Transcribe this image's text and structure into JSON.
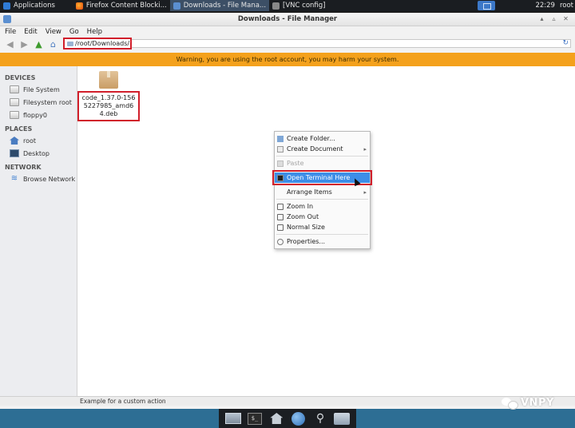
{
  "top_panel": {
    "apps_label": "Applications",
    "tasks": [
      {
        "label": "Firefox Content Blocki..."
      },
      {
        "label": "Downloads - File Mana..."
      },
      {
        "label": "[VNC config]"
      }
    ],
    "clock": "22:29",
    "user": "root"
  },
  "window": {
    "title": "Downloads - File Manager"
  },
  "menubar": {
    "items": [
      "File",
      "Edit",
      "View",
      "Go",
      "Help"
    ]
  },
  "address": {
    "path": "/root/Downloads/"
  },
  "warning": "Warning, you are using the root account, you may harm your system.",
  "sidebar": {
    "devices_header": "DEVICES",
    "devices": [
      "File System",
      "Filesystem root",
      "floppy0"
    ],
    "places_header": "PLACES",
    "places": [
      "root",
      "Desktop"
    ],
    "network_header": "NETWORK",
    "network": [
      "Browse Network"
    ]
  },
  "file": {
    "name": "code_1.37.0-1565227985_amd64.deb"
  },
  "context_menu": {
    "create_folder": "Create Folder...",
    "create_document": "Create Document",
    "paste": "Paste",
    "open_terminal": "Open Terminal Here",
    "arrange_items": "Arrange Items",
    "zoom_in": "Zoom In",
    "zoom_out": "Zoom Out",
    "normal_size": "Normal Size",
    "properties": "Properties..."
  },
  "statusbar": "Example for a custom action",
  "watermark": "VNPY",
  "colors": {
    "warning_bg": "#f4a11c",
    "highlight": "#3d8ee8",
    "annotation_red": "#d11f2b",
    "bottom_bar": "#2d6e94"
  }
}
